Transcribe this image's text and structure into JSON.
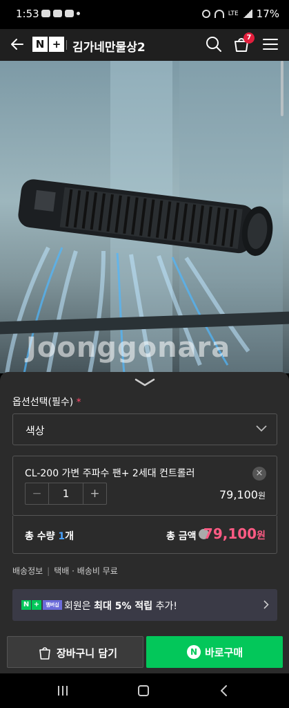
{
  "status_bar": {
    "time": "1:53",
    "battery": "17%",
    "network": "LTE"
  },
  "header": {
    "logo_letters": [
      "N",
      "+"
    ],
    "store_name": "김가네만물상2",
    "cart_count": "7"
  },
  "hero": {
    "watermark": "Joonggonara"
  },
  "option": {
    "title": "옵션선택(필수)",
    "required_mark": "*",
    "select_label": "색상"
  },
  "selected_item": {
    "name": "CL-200 가변 주파수 팬+ 2세대 컨트롤러",
    "remove_symbol": "×",
    "quantity": "1",
    "minus": "−",
    "plus": "+",
    "price": "79,100",
    "price_unit": "원"
  },
  "summary": {
    "qty_label": "총 수량",
    "qty_value": "1",
    "qty_unit": "개",
    "total_label": "총 금액",
    "total_value": "79,100",
    "total_unit": "원"
  },
  "shipping": {
    "label": "배송정보",
    "divider": "|",
    "text": "택배 · 배송비 무료"
  },
  "promo": {
    "badge_n": "N",
    "badge_plus": "+",
    "badge_membership": "멤버십",
    "text_prefix": "회원은 ",
    "text_bold": "최대 5% 적립",
    "text_suffix": " 추가!"
  },
  "buttons": {
    "cart": "장바구니 담기",
    "buy_icon": "N",
    "buy": "바로구매"
  },
  "colors": {
    "accent_green": "#03c75a",
    "price_pink": "#ff5b84",
    "badge_red": "#e21e3c",
    "qty_blue": "#4aa3ff"
  }
}
